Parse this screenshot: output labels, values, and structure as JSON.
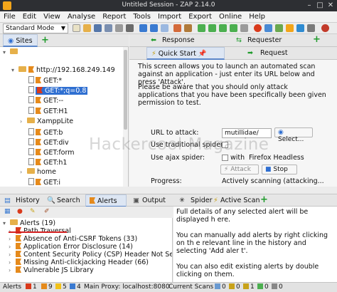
{
  "window": {
    "title": "Untitled Session - ZAP 2.14.0"
  },
  "menu": [
    "File",
    "Edit",
    "View",
    "Analyse",
    "Report",
    "Tools",
    "Import",
    "Export",
    "Online",
    "Help"
  ],
  "toolbar": {
    "mode": "Standard Mode"
  },
  "sites": {
    "tab_label": "Sites",
    "host": "http://192.168.249.149",
    "nodes": [
      "GET:*",
      "GET:*;q=0.8",
      "GET:--",
      "GET:H1",
      "XamppLite",
      "GET:b",
      "GET:div",
      "GET:form",
      "GET:h1",
      "home",
      "GET:i"
    ]
  },
  "right_tabs": {
    "response": "Response",
    "requester": "Requester",
    "quick_start": "Quick Start",
    "request": "Request"
  },
  "quick_start": {
    "intro": "This screen allows you to launch an automated scan against an application - just enter its URL below and press 'Attack'.",
    "warning": "Please be aware that you should only attack applications that you have been specifically been given permission to test.",
    "url_label": "URL to attack:",
    "url_value": "mutillidae/",
    "select_label": "Select...",
    "traditional_label": "Use traditional spider:",
    "ajax_label": "Use ajax spider:",
    "with_label": "with",
    "browser": "Firefox Headless",
    "attack_label": "Attack",
    "stop_label": "Stop",
    "progress_label": "Progress:",
    "progress_value": "Actively scanning (attacking..."
  },
  "watermark": "Hackercool Magazine",
  "bottom_tabs": {
    "history": "History",
    "search": "Search",
    "alerts": "Alerts",
    "output": "Output",
    "spider": "Spider",
    "active_scan": "Active Scan"
  },
  "alerts": {
    "root": "Alerts (19)",
    "items": [
      "Path Traversal",
      "Absence of Anti-CSRF Tokens (33)",
      "Application Error Disclosure (14)",
      "Content Security Policy (CSP) Header Not Set",
      "Missing Anti-clickjacking Header (66)",
      "Vulnerable JS Library"
    ]
  },
  "details": {
    "p1": "Full details of any selected alert will be displayed h ere.",
    "p2": "You can manually add alerts by right clicking on th e relevant line in the history and selecting 'Add aler t'.",
    "p3": "You can also edit existing alerts by double clicking on them."
  },
  "status": {
    "alerts_label": "Alerts",
    "c1": "1",
    "c2": "9",
    "c3": "5",
    "c4": "4",
    "proxy": "Main Proxy: localhost:8080",
    "scans": "Current Scans",
    "s1": "0",
    "s2": "0",
    "s3": "1",
    "s4": "0",
    "s5": "0"
  }
}
